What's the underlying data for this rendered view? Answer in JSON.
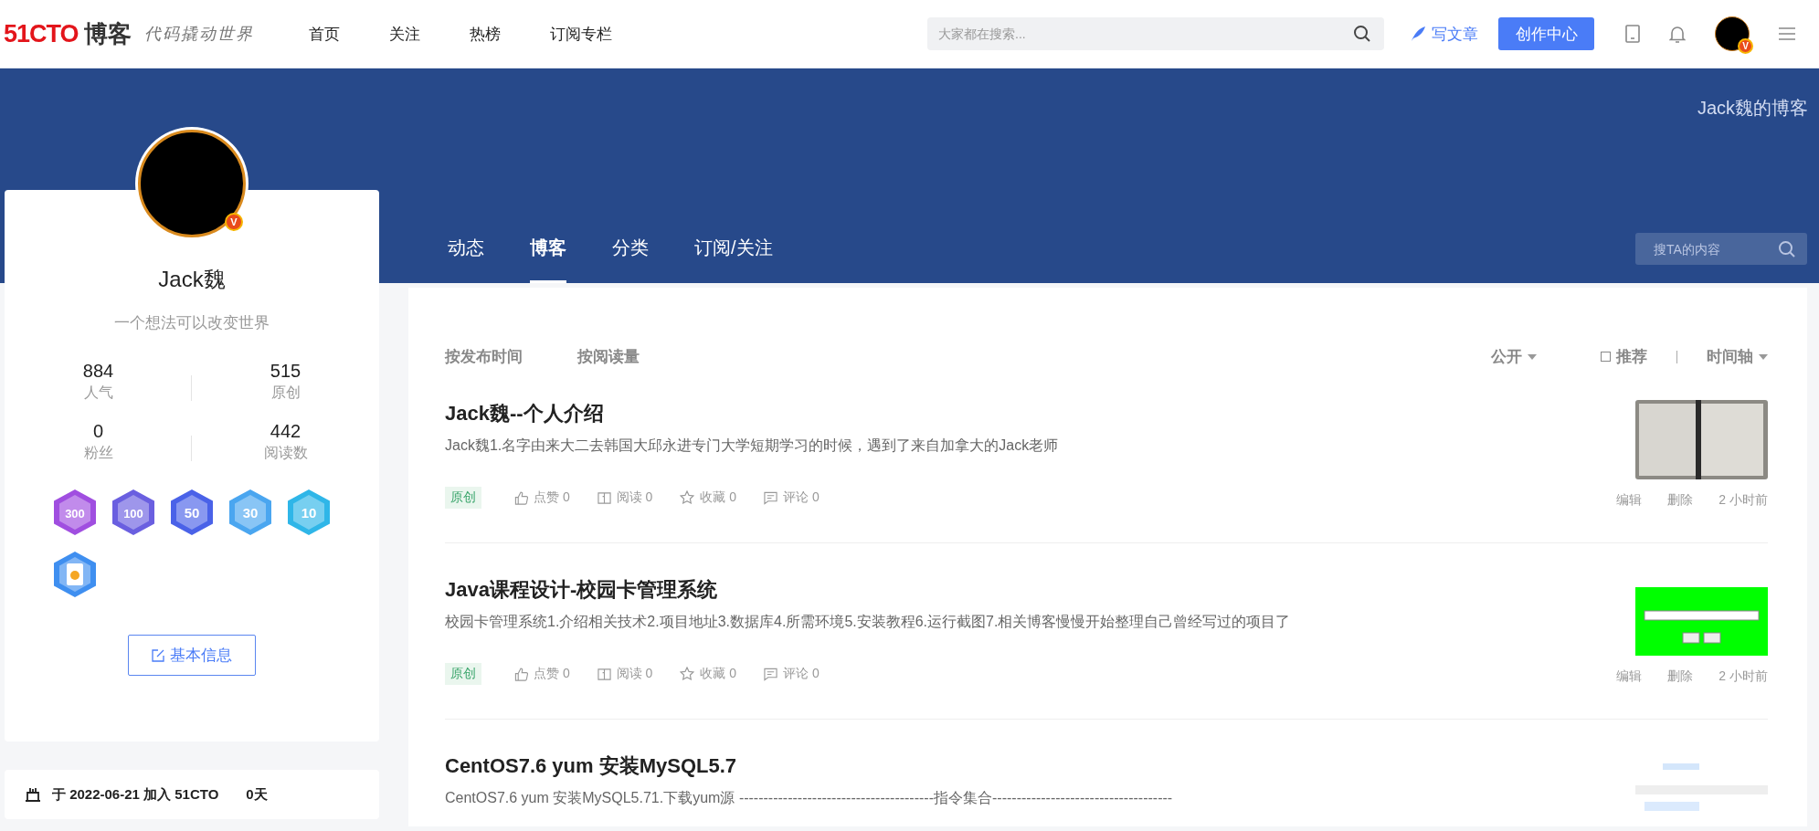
{
  "header": {
    "logo": "51CTO",
    "logo_suffix": "博客",
    "slogan": "代码撬动世界",
    "nav": [
      {
        "label": "首页"
      },
      {
        "label": "关注"
      },
      {
        "label": "热榜"
      },
      {
        "label": "订阅专栏"
      }
    ],
    "search": {
      "placeholder": "大家都在搜索..."
    },
    "write_link": "写文章",
    "creator_button": "创作中心",
    "avatar_mark": "V"
  },
  "banner": {
    "title": "Jack魏的博客",
    "tabs": [
      {
        "label": "动态",
        "selected": false
      },
      {
        "label": "博客",
        "selected": true
      },
      {
        "label": "分类",
        "selected": false
      },
      {
        "label": "订阅/关注",
        "selected": false
      }
    ],
    "search": {
      "placeholder": "搜TA的内容"
    }
  },
  "profile": {
    "avatar_mark": "V",
    "name": "Jack魏",
    "bio": "一个想法可以改变世界",
    "stats": [
      {
        "value": "884",
        "label": "人气"
      },
      {
        "value": "515",
        "label": "原创"
      },
      {
        "value": "0",
        "label": "粉丝"
      },
      {
        "value": "442",
        "label": "阅读数"
      }
    ],
    "badges": [
      {
        "kind": "number",
        "text": "300",
        "color": "#a04ee0"
      },
      {
        "kind": "number",
        "text": "100",
        "color": "#6a5fe0"
      },
      {
        "kind": "number",
        "text": "50",
        "color": "#4a62e8"
      },
      {
        "kind": "number",
        "text": "30",
        "color": "#4aa6f0"
      },
      {
        "kind": "number",
        "text": "10",
        "color": "#2fb6e8"
      },
      {
        "kind": "id-card",
        "color": "#3f8ff0"
      }
    ],
    "edit_button": "基本信息"
  },
  "join": {
    "prefix": "于",
    "date": "2022-06-21",
    "suffix": "加入 51CTO",
    "days": "0天"
  },
  "filters": {
    "sort": [
      {
        "label": "按发布时间"
      },
      {
        "label": "按阅读量"
      }
    ],
    "visibility": "公开",
    "recommend": {
      "label": "推荐",
      "checked": false
    },
    "view": "时间轴"
  },
  "articles": [
    {
      "title": "Jack魏--个人介绍",
      "summary": "Jack魏1.名字由来大二去韩国大邱永进专门大学短期学习的时候，遇到了来自加拿大的Jack老师",
      "thumbnail": {
        "kind": "photo"
      },
      "tag": "原创",
      "stats": [
        {
          "kind": "like",
          "label": "点赞",
          "count": "0"
        },
        {
          "kind": "read",
          "label": "阅读",
          "count": "0"
        },
        {
          "kind": "favorite",
          "label": "收藏",
          "count": "0"
        },
        {
          "kind": "comment",
          "label": "评论",
          "count": "0"
        }
      ],
      "actions": [
        "编辑",
        "删除"
      ],
      "time": "2 小时前"
    },
    {
      "title": "Java课程设计-校园卡管理系统",
      "summary": "校园卡管理系统1.介绍相关技术2.项目地址3.数据库4.所需环境5.安装教程6.运行截图7.相关博客慢慢开始整理自己曾经写过的项目了",
      "thumbnail": {
        "kind": "app-window"
      },
      "tag": "原创",
      "stats": [
        {
          "kind": "like",
          "label": "点赞",
          "count": "0"
        },
        {
          "kind": "read",
          "label": "阅读",
          "count": "0"
        },
        {
          "kind": "favorite",
          "label": "收藏",
          "count": "0"
        },
        {
          "kind": "comment",
          "label": "评论",
          "count": "0"
        }
      ],
      "actions": [
        "编辑",
        "删除"
      ],
      "time": "2 小时前"
    },
    {
      "title": "CentOS7.6 yum 安装MySQL5.7",
      "summary": "CentOS7.6 yum 安装MySQL5.71.下载yum源 ----------------------------------------指令集合-------------------------------------",
      "thumbnail": {
        "kind": "code-screenshot"
      }
    }
  ]
}
